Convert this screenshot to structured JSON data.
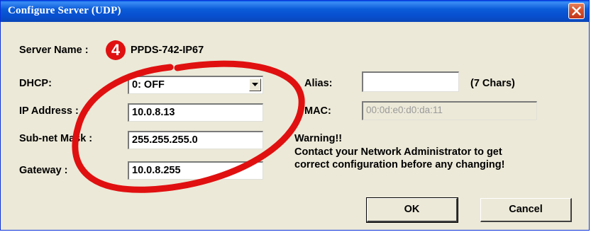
{
  "window": {
    "title": "Configure Server (UDP)"
  },
  "server_name": {
    "label": "Server Name :",
    "value": "PPDS-742-IP67"
  },
  "step_badge": "4",
  "dhcp": {
    "label": "DHCP:",
    "value": "0: OFF"
  },
  "ip": {
    "label": "IP Address :",
    "value": "10.0.8.13"
  },
  "subnet": {
    "label": "Sub-net Mask :",
    "value": "255.255.255.0"
  },
  "gateway": {
    "label": "Gateway :",
    "value": "10.0.8.255"
  },
  "alias": {
    "label": "Alias:",
    "value": "",
    "hint": "(7 Chars)"
  },
  "mac": {
    "label": "MAC:",
    "value": "00:0d:e0:d0:da:11"
  },
  "warning": {
    "line1": "Warning!!",
    "line2": "Contact your Network Administrator to get",
    "line3": "correct  configuration before any changing!"
  },
  "buttons": {
    "ok": "OK",
    "cancel": "Cancel"
  },
  "colors": {
    "title_bar": "#0a5fe8",
    "close_button": "#d5502a",
    "annotation": "#e01010",
    "dialog_bg": "#ece9d8"
  },
  "icons": {
    "close": "close-x-icon",
    "dropdown": "chevron-down-icon"
  }
}
